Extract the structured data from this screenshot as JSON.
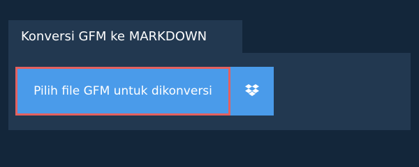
{
  "tab": {
    "title": "Konversi GFM ke MARKDOWN"
  },
  "upload": {
    "choose_label": "Pilih file GFM untuk dikonversi",
    "cloud_icon": "dropbox-icon"
  },
  "colors": {
    "background": "#13263a",
    "panel": "#223850",
    "button": "#4a9bea",
    "focus_border": "#e5615f",
    "text": "#ffffff"
  }
}
